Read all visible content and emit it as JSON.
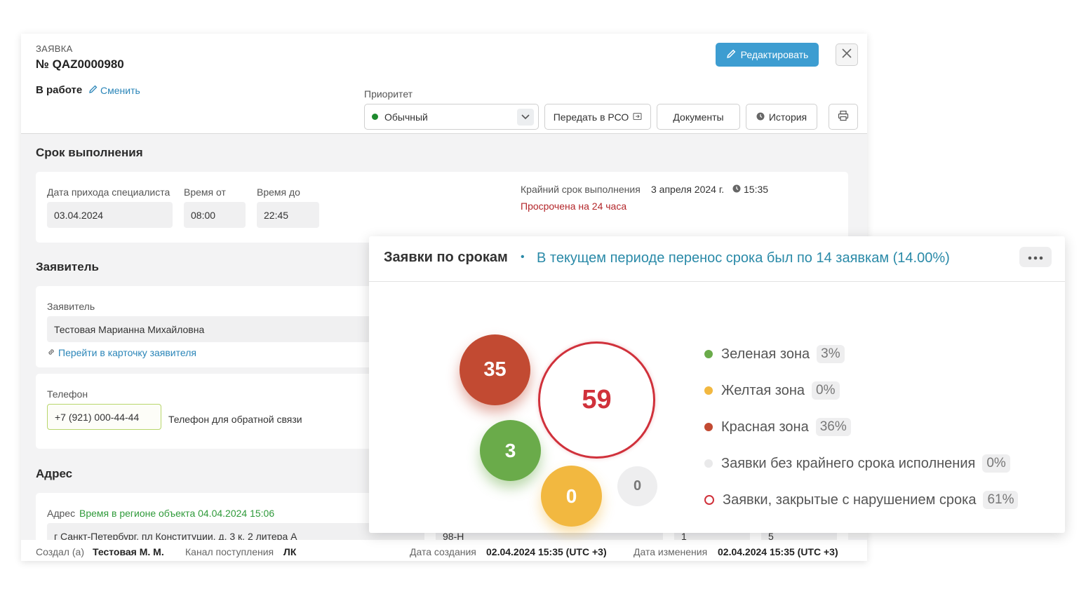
{
  "ticket": {
    "kicker": "ЗАЯВКА",
    "number": "№ QAZ0000980",
    "status": "В работе",
    "change_label": "Сменить",
    "edit_label": "Редактировать",
    "priority_label": "Приоритет",
    "priority_value": "Обычный",
    "priority_color": "#1e8a2e",
    "buttons": {
      "transfer": "Передать в РСО",
      "documents": "Документы",
      "history": "История"
    }
  },
  "deadline": {
    "title": "Срок выполнения",
    "arrival_label": "Дата прихода специалиста",
    "arrival_value": "03.04.2024",
    "time_from_label": "Время от",
    "time_from_value": "08:00",
    "time_to_label": "Время до",
    "time_to_value": "22:45",
    "final_label": "Крайний срок выполнения",
    "final_date": "3 апреля 2024 г.",
    "final_time": "15:35",
    "overdue": "Просрочена на 24 часа"
  },
  "applicant": {
    "title": "Заявитель",
    "label": "Заявитель",
    "value": "Тестовая Марианна Михайловна",
    "card_link": "Перейти в карточку заявителя",
    "phone_label": "Телефон",
    "phone_value": "+7 (921) 000-44-44",
    "phone_note": "Телефон для обратной связи"
  },
  "address": {
    "title": "Адрес",
    "label": "Адрес",
    "region_time": "Время в регионе объекта 04.04.2024 15:06",
    "value": "г Санкт-Петербург, пл Конституции, д. 3 к. 2 литера А",
    "extra1": "98-Н",
    "extra2": "1",
    "extra3": "5"
  },
  "footer": {
    "created_by_label": "Создал (а)",
    "created_by": "Тестовая М. М.",
    "channel_label": "Канал поступления",
    "channel": "ЛК",
    "created_label": "Дата создания",
    "created": "02.04.2024 15:35 (UTC +3)",
    "modified_label": "Дата изменения",
    "modified": "02.04.2024 15:35 (UTC +3)"
  },
  "widget": {
    "title": "Заявки по срокам",
    "subtitle": "В текущем периоде перенос срока был по 14 заявкам (14.00%)",
    "bubbles": {
      "red": "35",
      "closed_violation": "59",
      "green": "3",
      "yellow": "0",
      "no_deadline": "0"
    },
    "legend": [
      {
        "label": "Зеленая зона",
        "pct": "3%",
        "color": "#6aab4a"
      },
      {
        "label": "Желтая зона",
        "pct": "0%",
        "color": "#f2b840"
      },
      {
        "label": "Красная зона",
        "pct": "36%",
        "color": "#c24a32"
      },
      {
        "label": "Заявки без крайнего срока исполнения",
        "pct": "0%",
        "color": "#e9e9ea"
      },
      {
        "label": "Заявки, закрытые с нарушением срока",
        "pct": "61%",
        "color": "#d0313b"
      }
    ]
  }
}
